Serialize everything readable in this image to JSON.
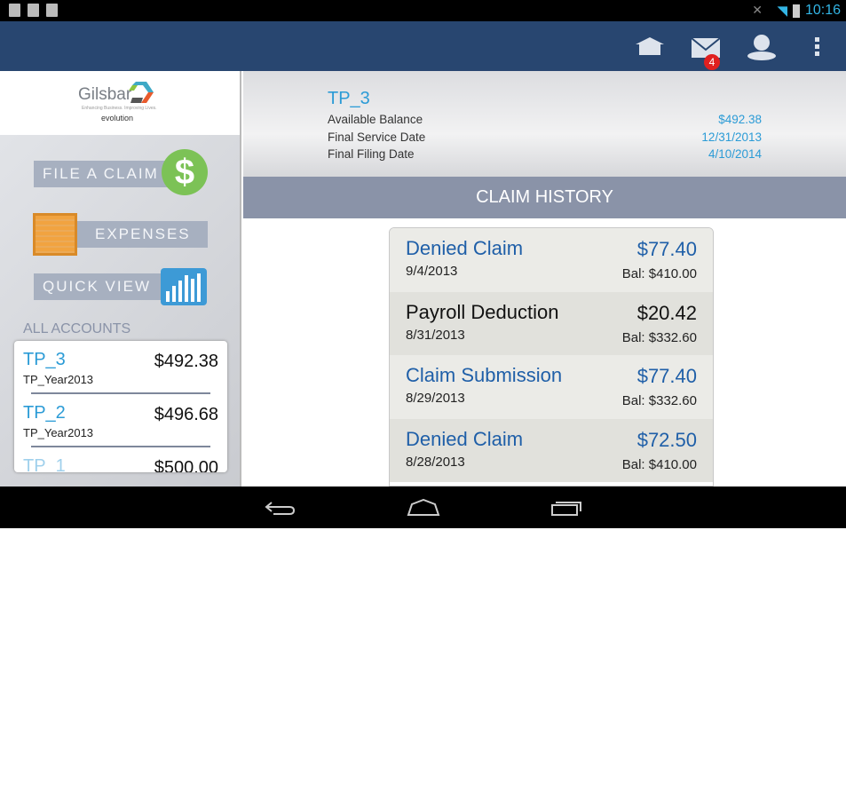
{
  "status": {
    "time": "10:16"
  },
  "actionbar": {
    "mail_badge": "4",
    "icons": [
      "home-icon",
      "mail-icon",
      "profile-icon",
      "overflow-menu-icon"
    ]
  },
  "logo": {
    "name": "Gilsbar",
    "tagline": "Enhancing Business. Improving Lives.",
    "powered": "powered by",
    "evolution": "evolution"
  },
  "menu": {
    "file_claim": "FILE A CLAIM",
    "expenses": "EXPENSES",
    "quick_view": "QUICK VIEW"
  },
  "accounts": {
    "title": "ALL ACCOUNTS",
    "items": [
      {
        "name": "TP_3",
        "amount": "$492.38",
        "sub": "TP_Year2013"
      },
      {
        "name": "TP_2",
        "amount": "$496.68",
        "sub": "TP_Year2013"
      },
      {
        "name": "TP_1",
        "amount": "$500.00",
        "sub": ""
      }
    ]
  },
  "header": {
    "title": "TP_3",
    "rows": [
      {
        "label": "Available Balance",
        "value": "$492.38"
      },
      {
        "label": "Final Service Date",
        "value": "12/31/2013"
      },
      {
        "label": "Final Filing Date",
        "value": "4/10/2014"
      }
    ]
  },
  "claim_history": {
    "title": "CLAIM HISTORY",
    "items": [
      {
        "desc": "Denied Claim",
        "amount": "$77.40",
        "date": "9/4/2013",
        "bal": "Bal: $410.00",
        "color": "#1f5fa8"
      },
      {
        "desc": "Payroll Deduction",
        "amount": "$20.42",
        "date": "8/31/2013",
        "bal": "Bal: $332.60",
        "color": "#111111"
      },
      {
        "desc": "Claim Submission",
        "amount": "$77.40",
        "date": "8/29/2013",
        "bal": "Bal: $332.60",
        "color": "#1f5fa8"
      },
      {
        "desc": "Denied Claim",
        "amount": "$72.50",
        "date": "8/28/2013",
        "bal": "Bal: $410.00",
        "color": "#1f5fa8"
      }
    ]
  }
}
